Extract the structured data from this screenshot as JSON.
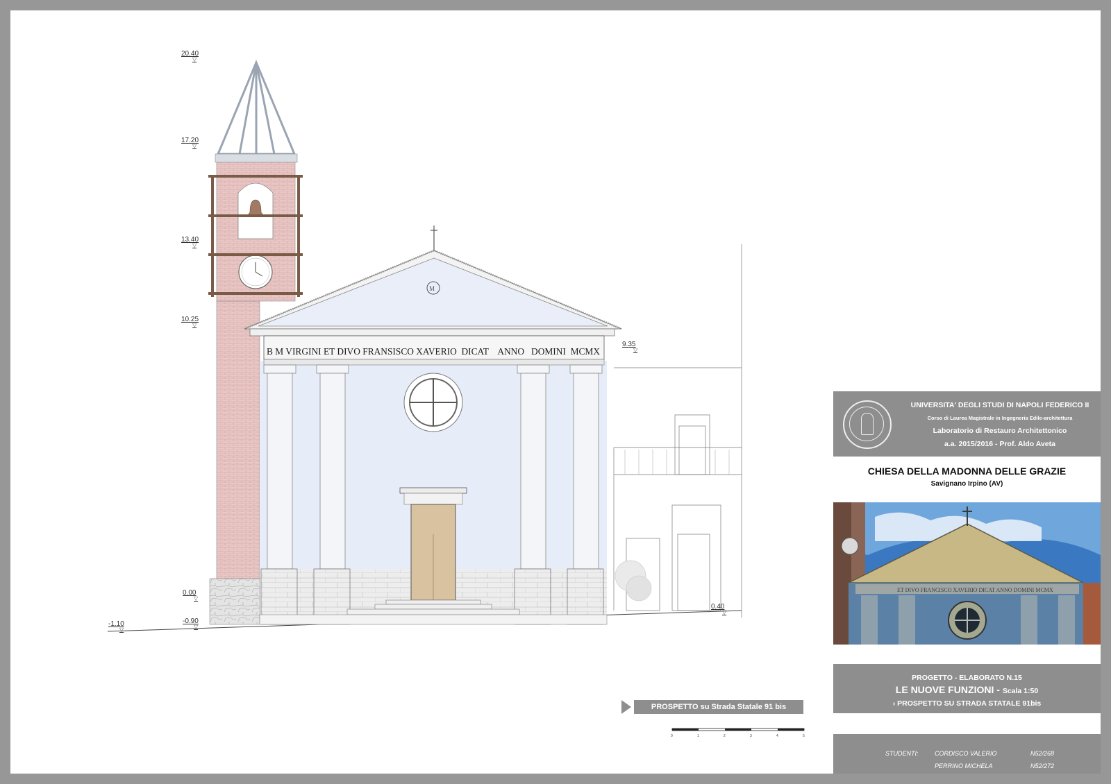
{
  "elevations": {
    "tower_top": "20.40",
    "bell_top": "17.20",
    "bell_mid": "13.40",
    "cornice": "10.25",
    "adjacent_roof": "9.35",
    "ground": "0.00",
    "step_left": "-0.90",
    "street_left": "-1.10",
    "street_right": "0.40"
  },
  "inscription": "B M VIRGINI ET DIVO FRANSISCO XAVERIO  DICAT    ANNO   DOMINI  MCMX",
  "view_label": "PROSPETTO su Strada Statale 91 bis",
  "title_block": {
    "university": "UNIVERSITA' DEGLI STUDI DI NAPOLI FEDERICO II",
    "course": "Corso di Laurea Magistrale in Ingegneria Edile-architettura",
    "lab": "Laboratorio di Restauro Architettonico",
    "year": "a.a. 2015/2016 - Prof. Aldo Aveta",
    "church_name": "CHIESA DELLA MADONNA DELLE GRAZIE",
    "location": "Savignano Irpino (AV)",
    "project": "PROGETTO - ELABORATO N.15",
    "theme": "LE NUOVE FUNZIONI",
    "theme_separator": " - ",
    "scale": "Scala 1:50",
    "sheet_subtitle": "PROSPETTO SU STRADA STATALE 91bis",
    "students_label": "STUDENTI:",
    "students": [
      {
        "name": "CORDISCO VALERIO",
        "id": "N52/268"
      },
      {
        "name": "PERRINO MICHELA",
        "id": "N52/272"
      }
    ]
  },
  "scalebar_ticks": [
    "0",
    "1",
    "2",
    "3",
    "4",
    "5"
  ],
  "photo_inscription": "ET DIVO FRANCISCO XAVERIO DICAT   ANNO DOMINI MCMX",
  "colors": {
    "sheet_border": "#979797",
    "title_gray": "#8e8e8e",
    "brick": "#e9c7c5",
    "plaster_blue": "#e6edf9",
    "stone": "#ececec",
    "door": "#d8c2a0",
    "bell_frame": "#7a5b47"
  }
}
